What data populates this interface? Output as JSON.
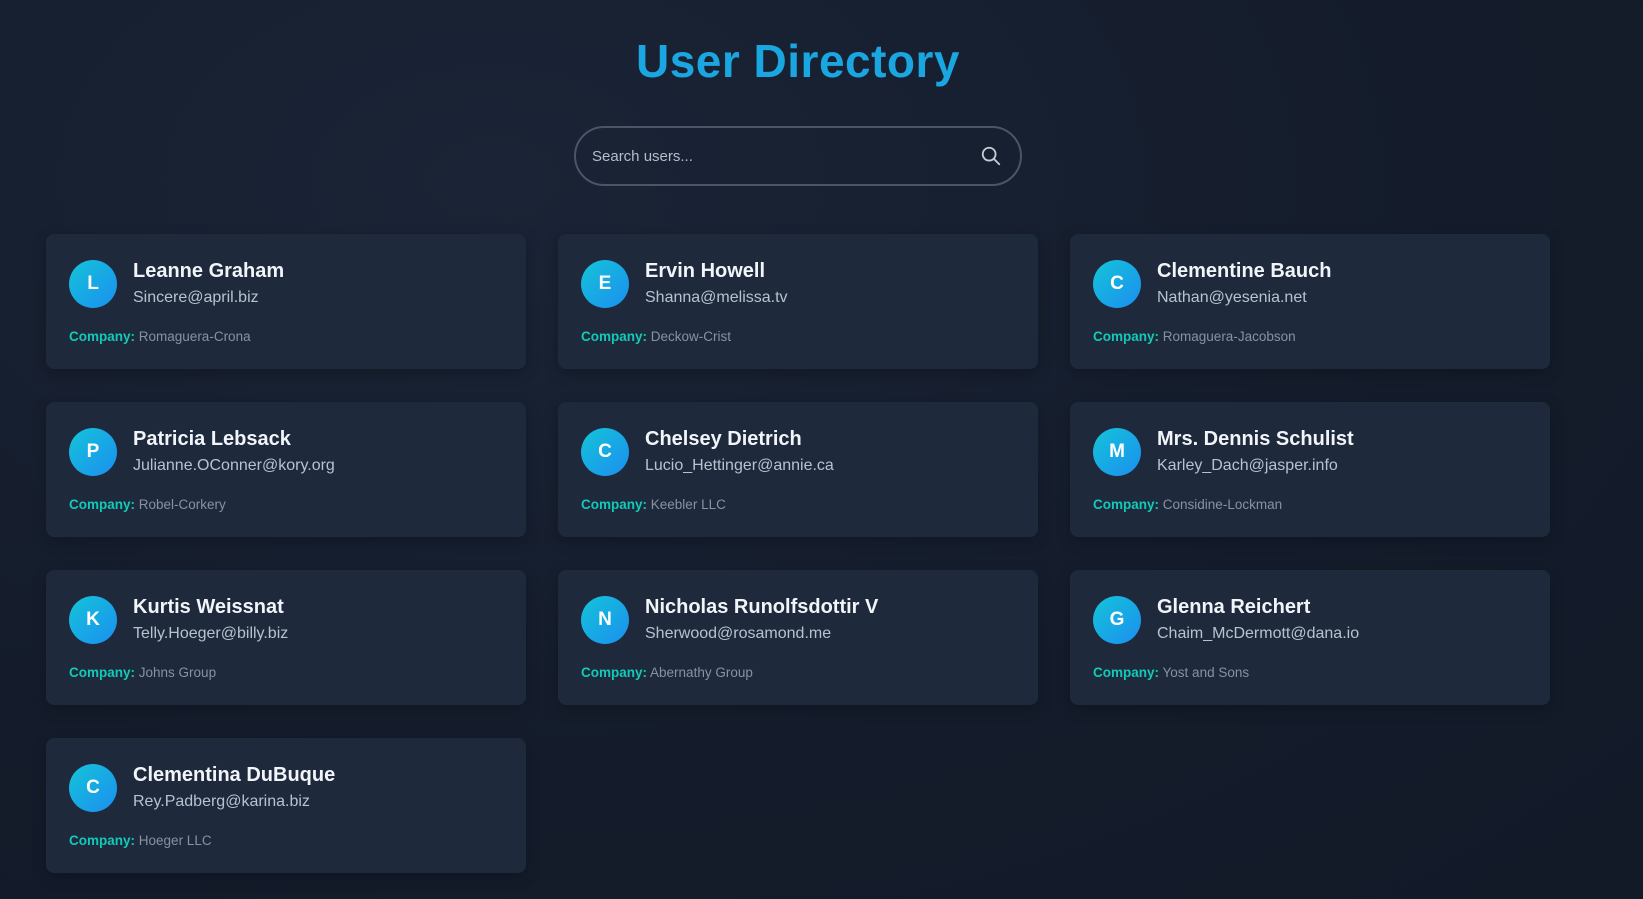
{
  "header": {
    "title": "User Directory"
  },
  "search": {
    "placeholder": "Search users...",
    "value": "",
    "icon": "search-icon"
  },
  "company_label": "Company:",
  "users": [
    {
      "initial": "L",
      "name": "Leanne Graham",
      "email": "Sincere@april.biz",
      "company": "Romaguera-Crona"
    },
    {
      "initial": "E",
      "name": "Ervin Howell",
      "email": "Shanna@melissa.tv",
      "company": "Deckow-Crist"
    },
    {
      "initial": "C",
      "name": "Clementine Bauch",
      "email": "Nathan@yesenia.net",
      "company": "Romaguera-Jacobson"
    },
    {
      "initial": "P",
      "name": "Patricia Lebsack",
      "email": "Julianne.OConner@kory.org",
      "company": "Robel-Corkery"
    },
    {
      "initial": "C",
      "name": "Chelsey Dietrich",
      "email": "Lucio_Hettinger@annie.ca",
      "company": "Keebler LLC"
    },
    {
      "initial": "M",
      "name": "Mrs. Dennis Schulist",
      "email": "Karley_Dach@jasper.info",
      "company": "Considine-Lockman"
    },
    {
      "initial": "K",
      "name": "Kurtis Weissnat",
      "email": "Telly.Hoeger@billy.biz",
      "company": "Johns Group"
    },
    {
      "initial": "N",
      "name": "Nicholas Runolfsdottir V",
      "email": "Sherwood@rosamond.me",
      "company": "Abernathy Group"
    },
    {
      "initial": "G",
      "name": "Glenna Reichert",
      "email": "Chaim_McDermott@dana.io",
      "company": "Yost and Sons"
    },
    {
      "initial": "C",
      "name": "Clementina DuBuque",
      "email": "Rey.Padberg@karina.biz",
      "company": "Hoeger LLC"
    }
  ],
  "colors": {
    "title": "#1aa6e0",
    "card_bg": "#1e293b",
    "company_label": "#14c9b8",
    "avatar_from": "#14c4d8",
    "avatar_to": "#1b8ef0"
  }
}
